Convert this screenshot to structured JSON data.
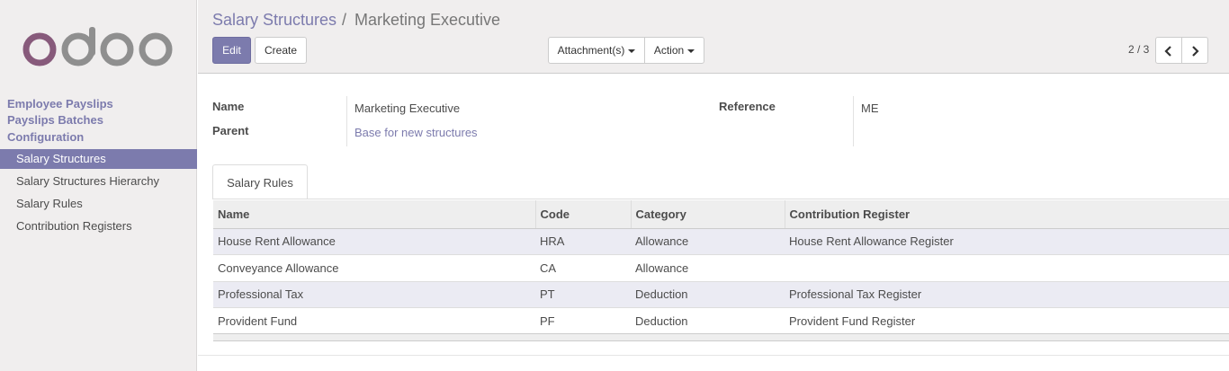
{
  "sidebar": {
    "logo_text": "odoo",
    "sections": [
      "Employee Payslips",
      "Payslips Batches",
      "Configuration"
    ],
    "items": [
      {
        "label": "Salary Structures",
        "active": true
      },
      {
        "label": "Salary Structures Hierarchy",
        "active": false
      },
      {
        "label": "Salary Rules",
        "active": false
      },
      {
        "label": "Contribution Registers",
        "active": false
      }
    ]
  },
  "breadcrumb": {
    "parent": "Salary Structures",
    "separator": "/",
    "current": "Marketing Executive"
  },
  "buttons": {
    "edit": "Edit",
    "create": "Create",
    "attachments": "Attachment(s)",
    "action": "Action"
  },
  "pager": {
    "value": "2 / 3",
    "prev_icon": "chevron-left-icon",
    "next_icon": "chevron-right-icon"
  },
  "form": {
    "name_label": "Name",
    "name_value": "Marketing Executive",
    "parent_label": "Parent",
    "parent_value": "Base for new structures",
    "reference_label": "Reference",
    "reference_value": "ME"
  },
  "tab": {
    "label": "Salary Rules"
  },
  "rules_table": {
    "headers": [
      "Name",
      "Code",
      "Category",
      "Contribution Register"
    ],
    "rows": [
      [
        "House Rent Allowance",
        "HRA",
        "Allowance",
        "House Rent Allowance Register"
      ],
      [
        "Conveyance Allowance",
        "CA",
        "Allowance",
        ""
      ],
      [
        "Professional Tax",
        "PT",
        "Deduction",
        "Professional Tax Register"
      ],
      [
        "Provident Fund",
        "PF",
        "Deduction",
        "Provident Fund Register"
      ]
    ]
  },
  "colors": {
    "brand": "#7c7bad",
    "logo_primary": "#875a7b",
    "logo_secondary": "#8f8f8f",
    "row_highlight": "#ebebf3"
  }
}
